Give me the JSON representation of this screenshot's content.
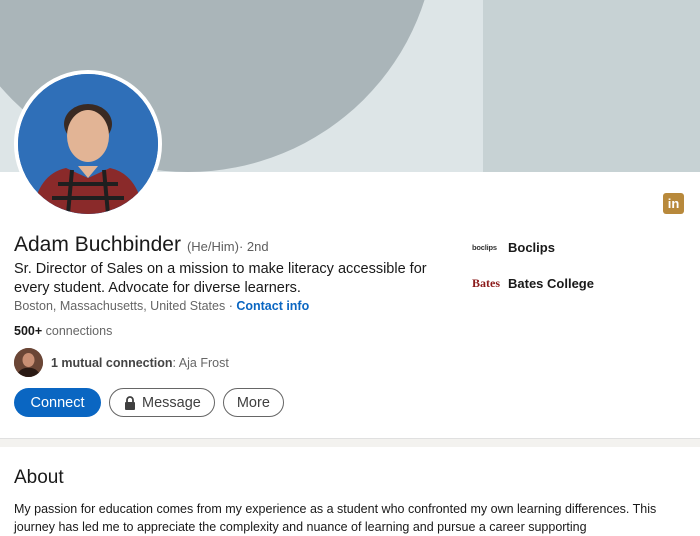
{
  "profile": {
    "name": "Adam Buchbinder",
    "pronouns": "(He/Him)",
    "degree": " · 2nd",
    "headline": "Sr. Director of Sales on a mission to make literacy accessible for every student. Advocate for diverse learners.",
    "location": "Boston, Massachusetts, United States",
    "location_separator": " · ",
    "contact_label": "Contact info",
    "connections_count": "500+",
    "connections_label": " connections",
    "mutual_prefix": "1 mutual connection",
    "mutual_name": ": Aja Frost"
  },
  "actions": {
    "connect_label": "Connect",
    "message_label": "Message",
    "more_label": "More"
  },
  "organizations": [
    {
      "logo_text": "boclips",
      "name": "Boclips"
    },
    {
      "logo_text": "Bates",
      "name": "Bates College"
    }
  ],
  "about": {
    "title": "About",
    "text": "My passion for education comes from my experience as a student who confronted my own learning differences. This journey has led me to appreciate the complexity and nuance of learning and pursue a career supporting"
  },
  "colors": {
    "brand_blue": "#0a66c2",
    "linkedin_badge": "#b8893b"
  },
  "icons": {
    "linkedin": "linkedin-icon",
    "lock": "lock-icon"
  },
  "linkedin_badge_text": "in"
}
